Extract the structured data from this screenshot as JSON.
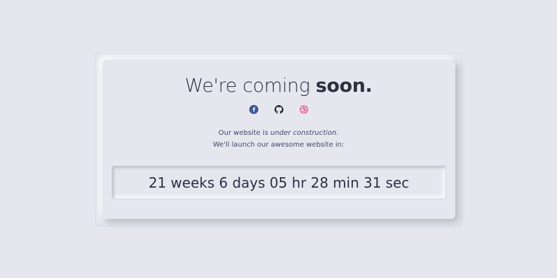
{
  "heading": {
    "prefix": "We're coming ",
    "bold": "soon."
  },
  "social": [
    {
      "icon": "facebook-icon",
      "color": "#3b5998"
    },
    {
      "icon": "github-icon",
      "color": "#24292e"
    },
    {
      "icon": "dribbble-icon",
      "color": "#ea4c89"
    }
  ],
  "message": {
    "line1_pre": "Our website is ",
    "line1_em": "under construction.",
    "line2": "We'll launch our awesome website in:"
  },
  "countdown": {
    "text": "21 weeks 6 days 05 hr 28 min 31 sec"
  }
}
